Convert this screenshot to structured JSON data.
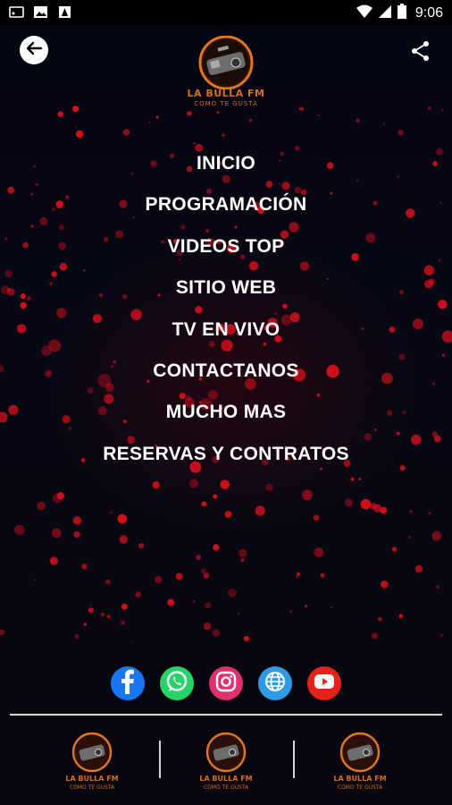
{
  "status_bar": {
    "time": "9:06",
    "icons": [
      "cast-icon",
      "image-icon",
      "app-icon",
      "wifi-icon",
      "signal-icon",
      "battery-icon"
    ]
  },
  "header": {
    "back_icon": "arrow-left-icon",
    "share_icon": "share-icon",
    "logo_title": "LA BULLA FM",
    "logo_subtitle": "COMO TE GUSTA"
  },
  "menu": {
    "items": [
      {
        "label": "INICIO"
      },
      {
        "label": "PROGRAMACIÓN"
      },
      {
        "label": "VIDEOS TOP"
      },
      {
        "label": "SITIO WEB"
      },
      {
        "label": "TV EN VIVO"
      },
      {
        "label": "CONTACTANOS"
      },
      {
        "label": "MUCHO MAS"
      },
      {
        "label": "RESERVAS Y CONTRATOS"
      }
    ]
  },
  "socials": [
    {
      "icon": "facebook-icon",
      "color": "#1877f2"
    },
    {
      "icon": "whatsapp-icon",
      "color": "#25d366"
    },
    {
      "icon": "instagram-icon",
      "color": "#e1306c"
    },
    {
      "icon": "globe-icon",
      "color": "#2f9be8"
    },
    {
      "icon": "youtube-icon",
      "color": "#e62117"
    }
  ],
  "bottom_logos": [
    {
      "title": "LA BULLA FM",
      "subtitle": "COMO TE GUSTA"
    },
    {
      "title": "LA BULLA FM",
      "subtitle": "COMO TE GUSTA"
    },
    {
      "title": "LA BULLA FM",
      "subtitle": "COMO TE GUSTA"
    }
  ],
  "colors": {
    "background": "#05060d",
    "particles": "#e0101c",
    "logo_text": "#d66e1e",
    "menu_text": "#ffffff"
  }
}
